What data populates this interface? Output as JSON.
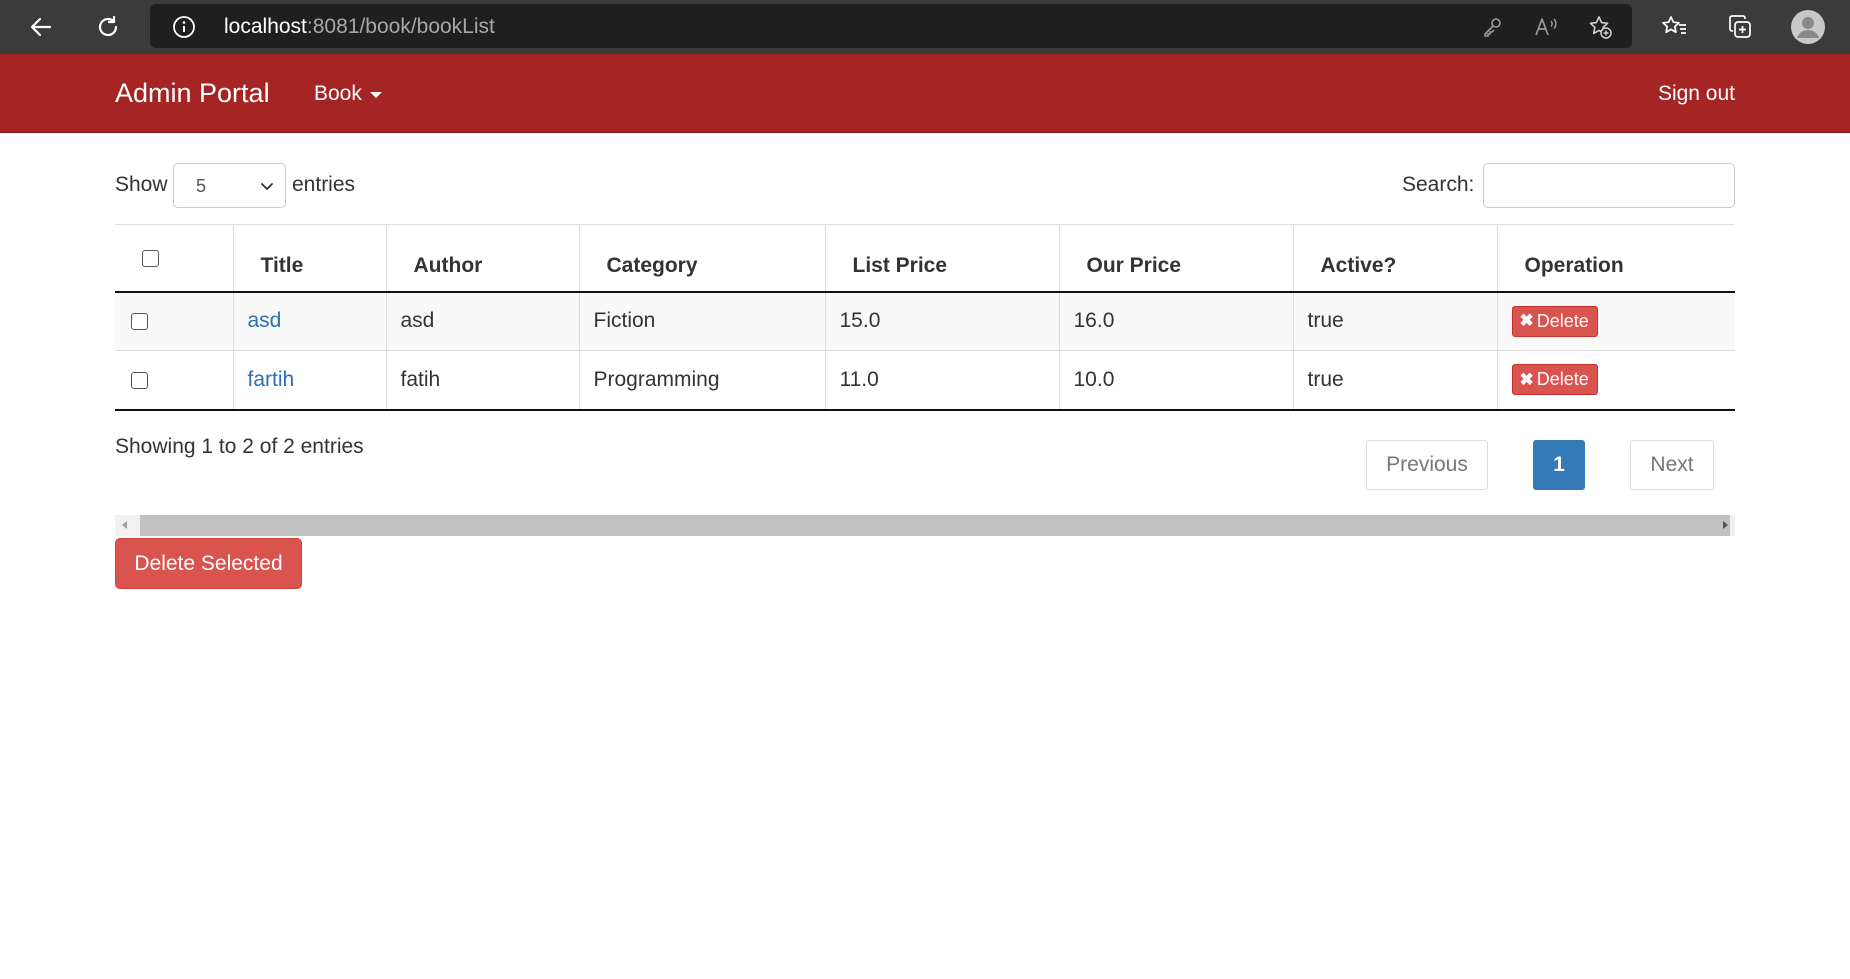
{
  "browser": {
    "url_host": "localhost",
    "url_rest": ":8081/book/bookList"
  },
  "navbar": {
    "brand": "Admin Portal",
    "menu_book": "Book",
    "sign_out": "Sign out",
    "bg_color": "#a52424"
  },
  "controls": {
    "show_label": "Show",
    "page_length": "5",
    "entries_label": "entries",
    "search_label": "Search:",
    "search_value": ""
  },
  "table": {
    "columns": [
      "Title",
      "Author",
      "Category",
      "List Price",
      "Our Price",
      "Active?",
      "Operation"
    ],
    "rows": [
      {
        "title": "asd",
        "author": "asd",
        "category": "Fiction",
        "list_price": "15.0",
        "our_price": "16.0",
        "active": "true",
        "op_label": "Delete"
      },
      {
        "title": "fartih",
        "author": "fatih",
        "category": "Programming",
        "list_price": "11.0",
        "our_price": "10.0",
        "active": "true",
        "op_label": "Delete"
      }
    ]
  },
  "footer": {
    "info": "Showing 1 to 2 of 2 entries",
    "prev": "Previous",
    "current_page": "1",
    "next": "Next",
    "delete_selected": "Delete Selected"
  },
  "colors": {
    "danger": "#d9534f",
    "primary": "#337ab7",
    "link": "#2a6eb5"
  }
}
